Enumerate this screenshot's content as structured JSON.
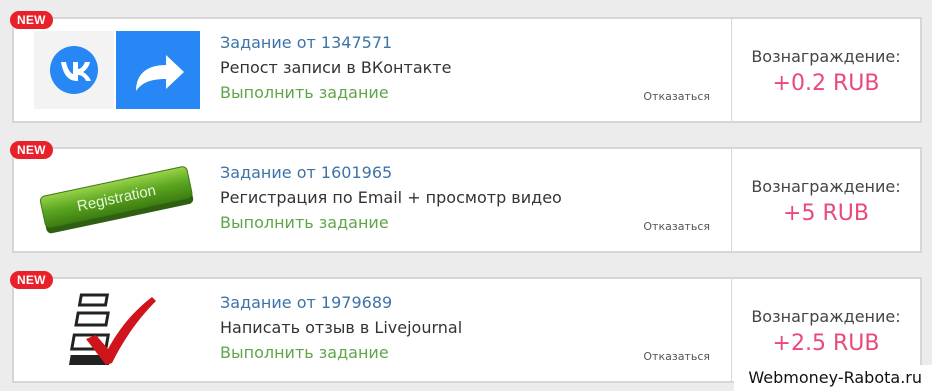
{
  "tasks": [
    {
      "badge": "NEW",
      "id_text": "Задание от 1347571",
      "title": "Репост записи в ВКонтакте",
      "action": "Выполнить задание",
      "decline": "Отказаться",
      "reward_label": "Вознаграждение:",
      "reward_value": "+0.2 RUB",
      "thumb_icon": "vk-repost-icon"
    },
    {
      "badge": "NEW",
      "id_text": "Задание от 1601965",
      "title": "Регистрация по Email + просмотр видео",
      "action": "Выполнить задание",
      "decline": "Отказаться",
      "reward_label": "Вознаграждение:",
      "reward_value": "+5 RUB",
      "thumb_icon": "registration-button-icon",
      "thumb_text": "Registration"
    },
    {
      "badge": "NEW",
      "id_text": "Задание от 1979689",
      "title": "Написать отзыв в Livejournal",
      "action": "Выполнить задание",
      "decline": "Отказаться",
      "reward_label": "Вознаграждение:",
      "reward_value": "+2.5 RUB",
      "thumb_icon": "checklist-icon"
    }
  ],
  "watermark": "Webmoney-Rabota.ru",
  "colors": {
    "badge": "#e8202a",
    "task_id": "#3d73a8",
    "action": "#5fa64a",
    "reward": "#e84a7a",
    "vk_blue": "#2787f5",
    "registration_green": "#58a51f"
  }
}
